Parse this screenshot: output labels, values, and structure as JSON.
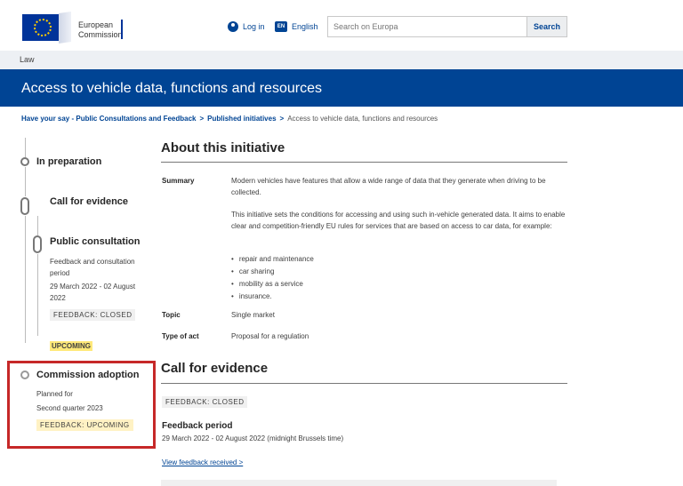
{
  "header": {
    "logo_line1": "European",
    "logo_line2": "Commission",
    "login": "Log in",
    "language": "English",
    "language_code": "EN",
    "search_placeholder": "Search on Europa",
    "search_button": "Search",
    "icons": [
      "user-icon",
      "language-icon"
    ],
    "colors": {
      "brand": "#004494",
      "flag": "#003399",
      "stars": "#ffcc00"
    }
  },
  "site_section": "Law",
  "page_title": "Access to vehicle data, functions and resources",
  "breadcrumb": [
    "Have your say - Public Consultations and Feedback",
    "Published initiatives",
    "Access to vehicle data, functions and resources"
  ],
  "breadcrumb_separator": ">",
  "timeline": {
    "in_preparation": "In preparation",
    "call_for_evidence": "Call for evidence",
    "public_consultation": {
      "title": "Public consultation",
      "subtitle": "Feedback and consultation period",
      "dates": "29 March 2022 - 02 August 2022",
      "tag": "FEEDBACK: CLOSED"
    },
    "upcoming_tag": "UPCOMING",
    "commission_adoption": {
      "title": "Commission adoption",
      "planned_label": "Planned for",
      "planned_value": "Second quarter 2023",
      "tag": "FEEDBACK: UPCOMING"
    },
    "highlight_color": "#c62828"
  },
  "about": {
    "heading": "About this initiative",
    "summary_label": "Summary",
    "summary_p1": "Modern vehicles have features that allow a wide range of data that they generate when driving to be collected.",
    "summary_p2": "This initiative sets the conditions for accessing and using such in-vehicle generated data. It aims to enable clear and competition-friendly EU rules for services that are based on access to car data, for example:",
    "bullets": [
      "repair and maintenance",
      "car sharing",
      "mobility as a service",
      "insurance."
    ],
    "topic_label": "Topic",
    "topic_value": "Single market",
    "type_label": "Type of act",
    "type_value": "Proposal for a regulation"
  },
  "call_for_evidence": {
    "heading": "Call for evidence",
    "tag": "FEEDBACK: CLOSED",
    "feedback_period_label": "Feedback period",
    "feedback_period_value": "29 March 2022 - 02 August 2022  (midnight Brussels time)",
    "view_feedback": "View feedback received >"
  }
}
